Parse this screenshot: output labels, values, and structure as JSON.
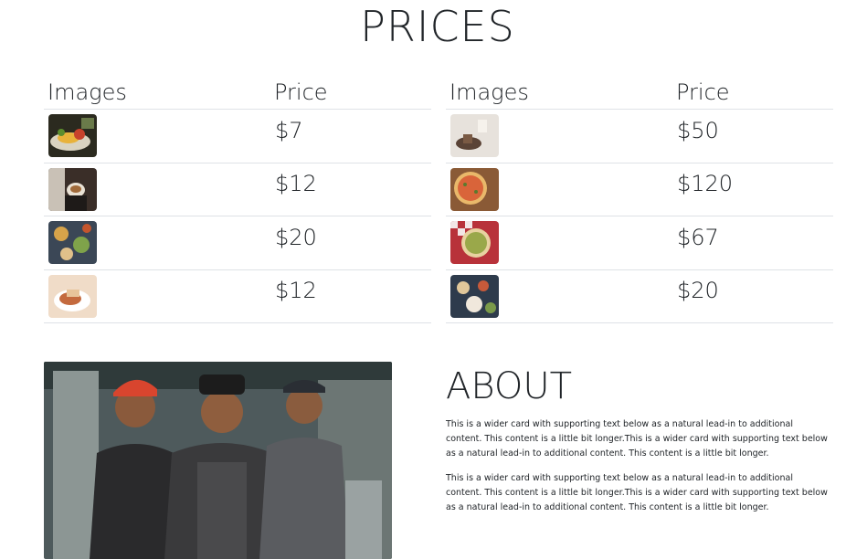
{
  "prices": {
    "title": "PRICES",
    "left_table": {
      "headers": {
        "images": "Images",
        "price": "Price"
      },
      "rows": [
        {
          "image": "food-plate-image",
          "price": "$7"
        },
        {
          "image": "coffee-cup-image",
          "price": "$12"
        },
        {
          "image": "food-table-image",
          "price": "$20"
        },
        {
          "image": "dessert-plate-image",
          "price": "$12"
        }
      ]
    },
    "right_table": {
      "headers": {
        "images": "Images",
        "price": "Price"
      },
      "rows": [
        {
          "image": "cafe-table-image",
          "price": "$50"
        },
        {
          "image": "pizza-board-image",
          "price": "$120"
        },
        {
          "image": "pizza-tablecloth-image",
          "price": "$67"
        },
        {
          "image": "shared-dishes-image",
          "price": "$20"
        }
      ]
    }
  },
  "about": {
    "title": "ABOUT",
    "paragraphs": [
      "This is a wider card with supporting text below as a natural lead-in to additional content. This content is a little bit longer.This is a wider card with supporting text below as a natural lead-in to additional content. This content is a little bit longer.",
      "This is a wider card with supporting text below as a natural lead-in to additional content. This content is a little bit longer.This is a wider card with supporting text below as a natural lead-in to additional content. This content is a little bit longer."
    ],
    "photo": "chefs-team-photo"
  }
}
